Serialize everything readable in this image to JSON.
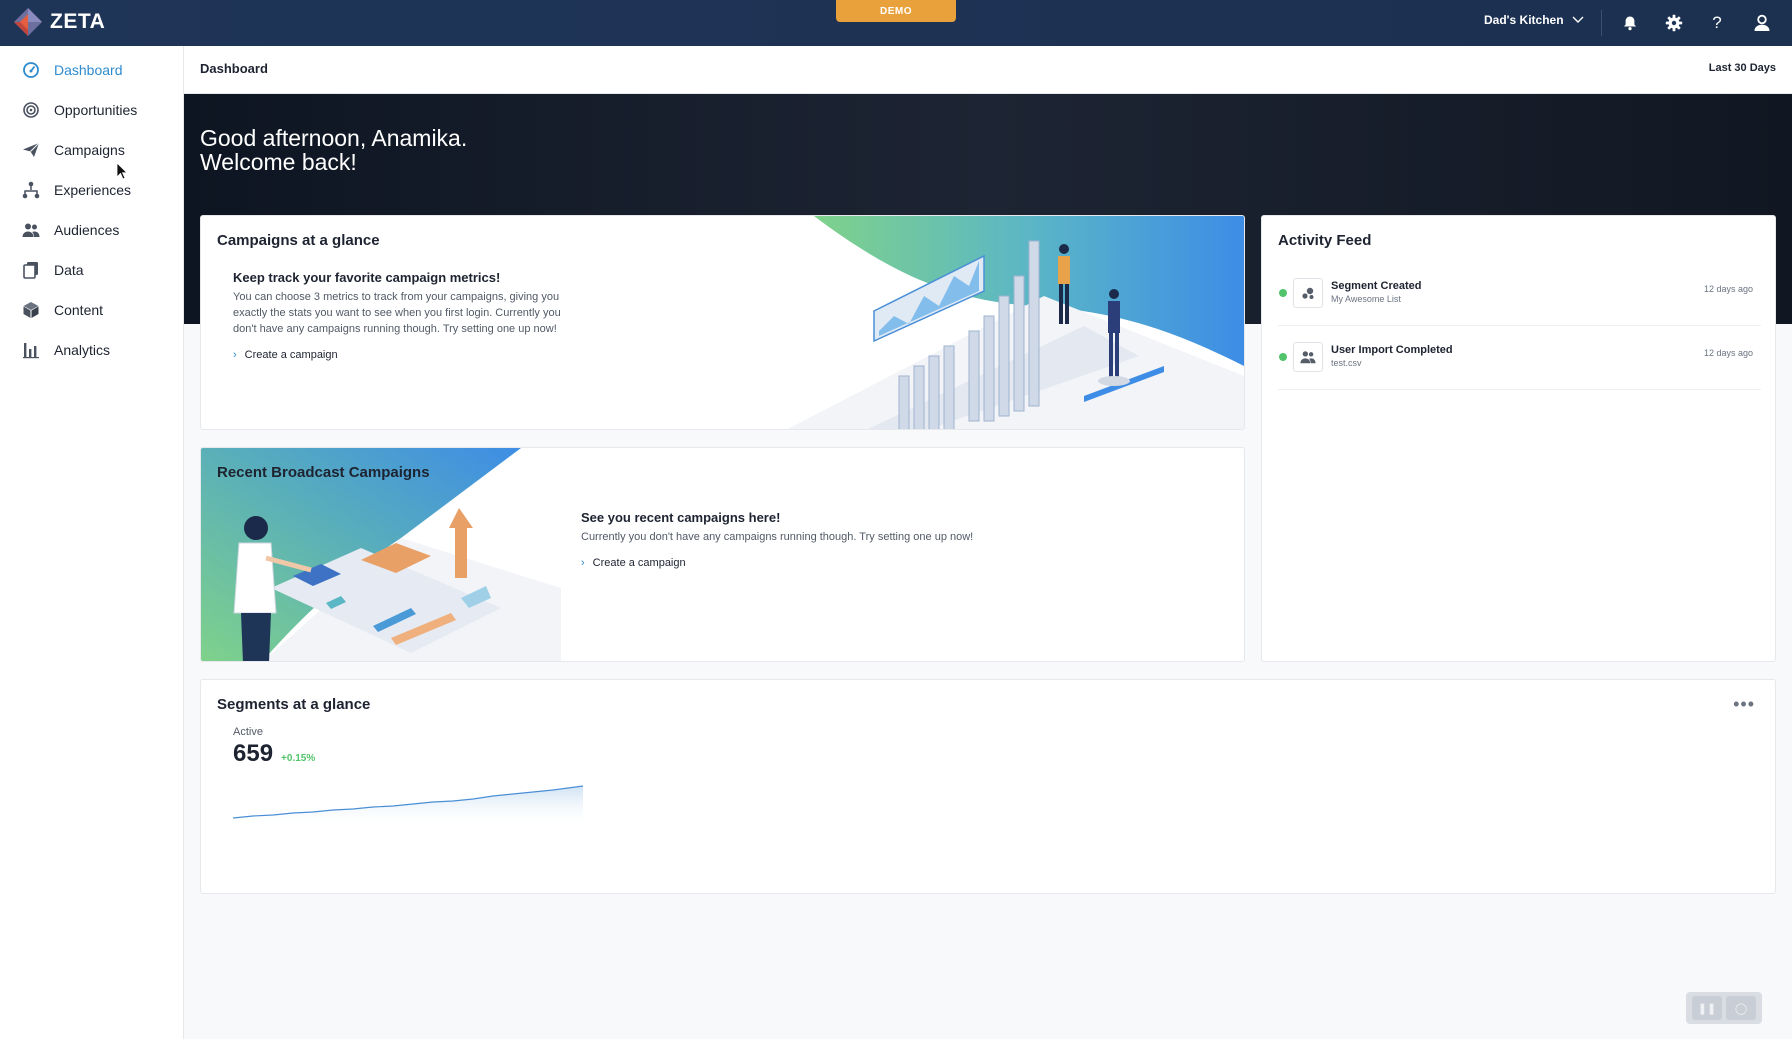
{
  "app": {
    "name": "ZETA",
    "demo_badge": "DEMO",
    "account": "Dad's Kitchen"
  },
  "sidebar": {
    "items": [
      {
        "label": "Dashboard",
        "icon": "gauge-icon"
      },
      {
        "label": "Opportunities",
        "icon": "target-icon"
      },
      {
        "label": "Campaigns",
        "icon": "paper-plane-icon"
      },
      {
        "label": "Experiences",
        "icon": "hierarchy-icon"
      },
      {
        "label": "Audiences",
        "icon": "people-icon"
      },
      {
        "label": "Data",
        "icon": "copy-icon"
      },
      {
        "label": "Content",
        "icon": "box-icon"
      },
      {
        "label": "Analytics",
        "icon": "bar-chart-icon"
      }
    ]
  },
  "header": {
    "title": "Dashboard",
    "range": "Last 30 Days"
  },
  "hero": {
    "line1": "Good afternoon, Anamika.",
    "line2": "Welcome back!"
  },
  "campaigns_glance": {
    "title": "Campaigns at a glance",
    "heading": "Keep track your favorite campaign metrics!",
    "body": "You can choose 3 metrics to track from your campaigns, giving you exactly the stats you want to see when you first login. Currently you don't have any campaigns running though. Try setting one up now!",
    "link": "Create a campaign"
  },
  "broadcast": {
    "title": "Recent Broadcast Campaigns",
    "heading": "See you recent campaigns here!",
    "body": "Currently you don't have any campaigns running though. Try setting one up now!",
    "link": "Create a campaign"
  },
  "activity": {
    "title": "Activity Feed",
    "items": [
      {
        "title": "Segment Created",
        "sub": "My Awesome List",
        "time": "12 days ago",
        "icon": "segment-icon"
      },
      {
        "title": "User Import Completed",
        "sub": "test.csv",
        "time": "12 days ago",
        "icon": "users-icon"
      }
    ]
  },
  "segments": {
    "title": "Segments at a glance",
    "label": "Active",
    "value": "659",
    "change": "+0.15%"
  },
  "colors": {
    "accent": "#2e8bcf",
    "topbar": "#1f3558",
    "demo": "#e9a23b",
    "status": "#52c46b"
  }
}
